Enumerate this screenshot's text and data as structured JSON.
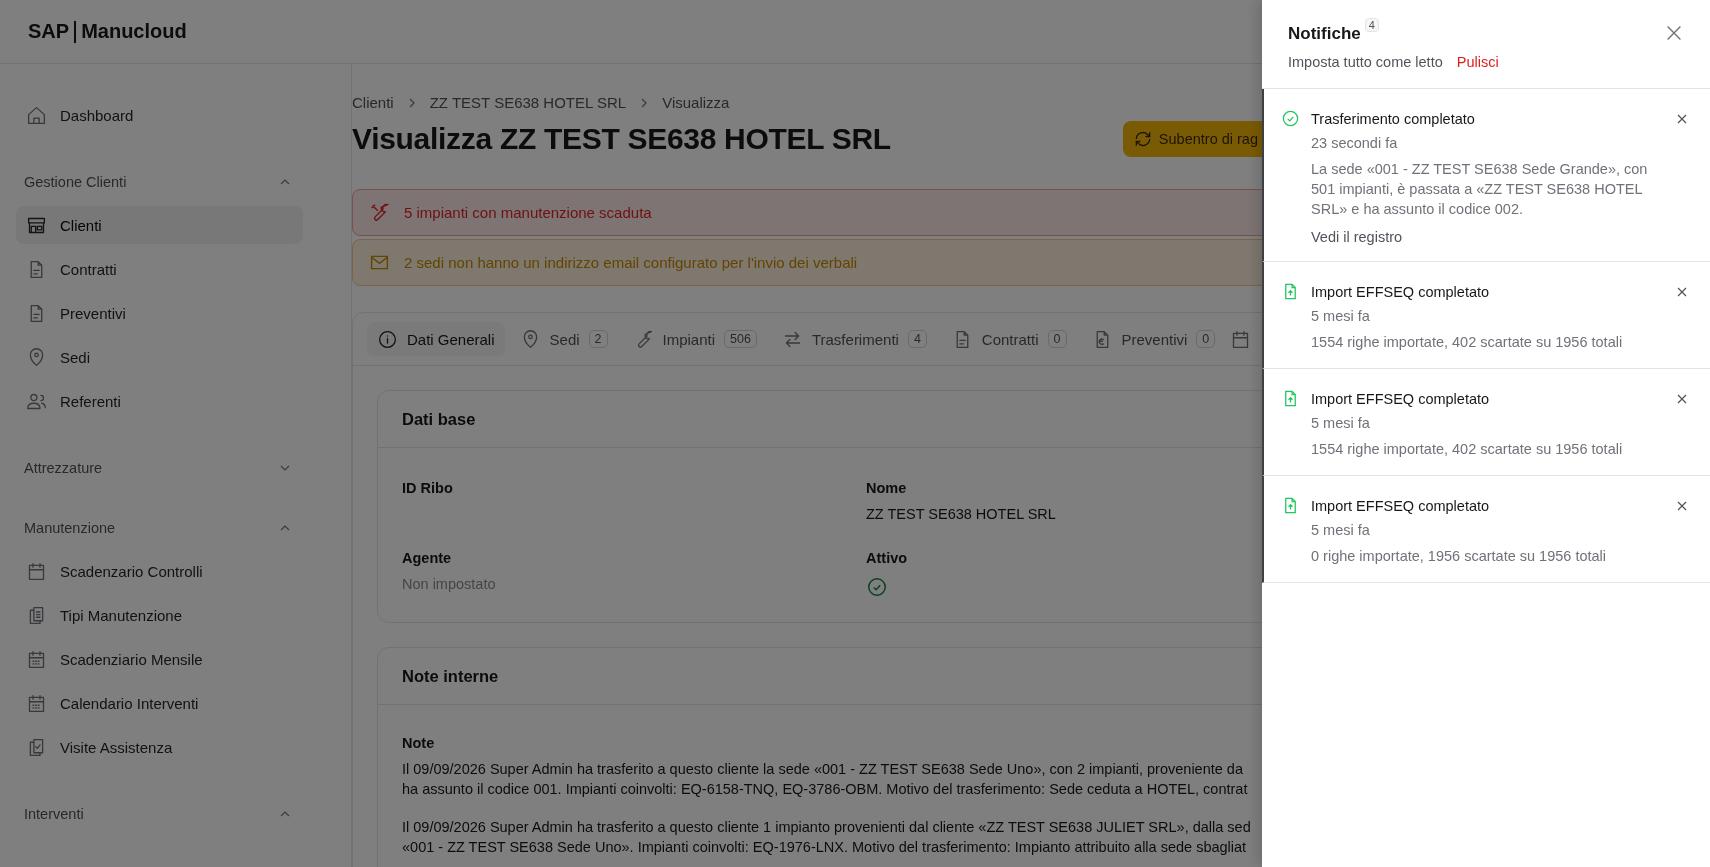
{
  "header": {
    "logo_left": "SAP",
    "logo_right": "Manucloud"
  },
  "sidebar": {
    "top_items": [
      {
        "label": "Dashboard",
        "selected": false
      }
    ],
    "sections": [
      {
        "title": "Gestione Clienti",
        "expanded": true,
        "items": [
          {
            "label": "Clienti",
            "selected": true
          },
          {
            "label": "Contratti",
            "selected": false
          },
          {
            "label": "Preventivi",
            "selected": false
          },
          {
            "label": "Sedi",
            "selected": false
          },
          {
            "label": "Referenti",
            "selected": false
          }
        ]
      },
      {
        "title": "Attrezzature",
        "expanded": false
      },
      {
        "title": "Manutenzione",
        "expanded": true,
        "items": [
          {
            "label": "Scadenzario Controlli",
            "selected": false
          },
          {
            "label": "Tipi Manutenzione",
            "selected": false
          },
          {
            "label": "Scadenziario Mensile",
            "selected": false
          },
          {
            "label": "Calendario Interventi",
            "selected": false
          },
          {
            "label": "Visite Assistenza",
            "selected": false
          }
        ]
      },
      {
        "title": "Interventi",
        "expanded": true
      }
    ]
  },
  "breadcrumb": [
    "Clienti",
    "ZZ TEST SE638 HOTEL SRL",
    "Visualizza"
  ],
  "page_title": "Visualizza ZZ TEST SE638 HOTEL SRL",
  "action_button": "Subentro di rag",
  "alerts": [
    {
      "kind": "danger",
      "text": "5 impianti con manutenzione scaduta"
    },
    {
      "kind": "warning",
      "text": "2 sedi non hanno un indirizzo email configurato per l'invio dei verbali"
    }
  ],
  "tabs": [
    {
      "label": "Dati Generali",
      "selected": true
    },
    {
      "label": "Sedi",
      "count": "2",
      "selected": false
    },
    {
      "label": "Impianti",
      "count": "506",
      "selected": false
    },
    {
      "label": "Trasferimenti",
      "count": "4",
      "selected": false
    },
    {
      "label": "Contratti",
      "count": "0",
      "selected": false
    },
    {
      "label": "Preventivi",
      "count": "0",
      "selected": false
    }
  ],
  "basic_data": {
    "title": "Dati base",
    "fields": [
      {
        "label": "ID Ribo",
        "kind": "text"
      },
      {
        "label": "Nome",
        "kind": "text",
        "value": "ZZ TEST SE638 HOTEL SRL"
      },
      {
        "label": "Agente",
        "kind": "unset",
        "value": "Non impostato"
      },
      {
        "label": "Attivo",
        "kind": "bool",
        "checked": true
      }
    ]
  },
  "internal_notes": {
    "title": "Note interne",
    "label": "Note",
    "paragraphs": [
      [
        "Il 09/09/2026 Super Admin ha trasferito a questo cliente la sede «001 - ZZ TEST SE638 Sede Uno», con 2 impianti, proveniente da",
        "ha assunto il codice 001. Impianti coinvolti: EQ-6158-TNQ, EQ-3786-OBM. Motivo del trasferimento: Sede ceduta a HOTEL, contrat"
      ],
      [
        "Il 09/09/2026 Super Admin ha trasferito a questo cliente 1 impianto provenienti dal cliente «ZZ TEST SE638 JULIET SRL», dalla sed",
        "«001 - ZZ TEST SE638 Sede Uno». Impianti coinvolti: EQ-1976-LNX. Motivo del trasferimento: Impianto attribuito alla sede sbagliat"
      ]
    ]
  },
  "notifications": {
    "title": "Notifiche",
    "count": "4",
    "mark_all_read": "Imposta tutto come letto",
    "clear": "Pulisci",
    "items": [
      {
        "kind": "transfer",
        "unread": true,
        "title": "Trasferimento completato",
        "time": "23 secondi fa",
        "body": "La sede «001 - ZZ TEST SE638 Sede Grande», con 501 impianti, è passata a «ZZ TEST SE638 HOTEL SRL» e ha assunto il codice 002.",
        "link": "Vedi il registro"
      },
      {
        "kind": "import",
        "unread": true,
        "title": "Import EFFSEQ completato",
        "time": "5 mesi fa",
        "body": "1554 righe importate, 402 scartate su 1956 totali"
      },
      {
        "kind": "import",
        "unread": true,
        "title": "Import EFFSEQ completato",
        "time": "5 mesi fa",
        "body": "1554 righe importate, 402 scartate su 1956 totali"
      },
      {
        "kind": "import",
        "unread": true,
        "title": "Import EFFSEQ completato",
        "time": "5 mesi fa",
        "body": "0 righe importate, 1956 scartate su 1956 totali"
      }
    ]
  }
}
